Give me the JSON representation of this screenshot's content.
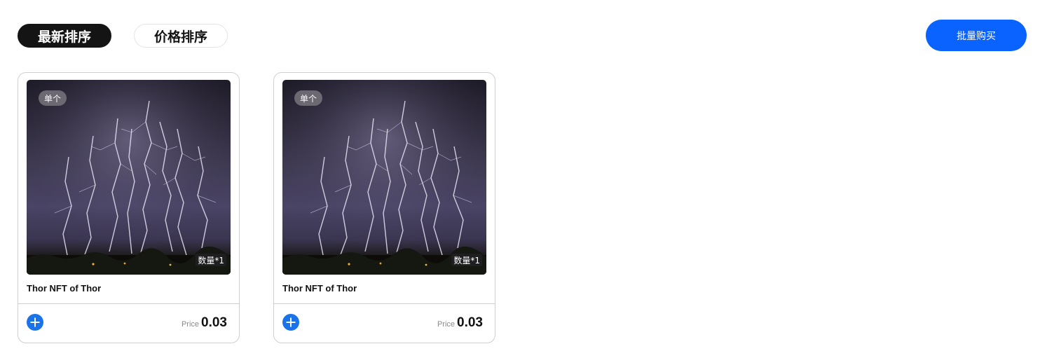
{
  "sort": {
    "latest_label": "最新排序",
    "price_label": "价格排序"
  },
  "bulk_buy_label": "批量购买",
  "cards": [
    {
      "type_badge": "单个",
      "quantity_badge": "数量*1",
      "name": "Thor NFT of Thor",
      "price_label": "Price",
      "price_value": "0.03"
    },
    {
      "type_badge": "单个",
      "quantity_badge": "数量*1",
      "name": "Thor NFT of Thor",
      "price_label": "Price",
      "price_value": "0.03"
    }
  ],
  "colors": {
    "accent": "#0a62ff",
    "add_button": "#1a73e8",
    "active_sort_bg": "#141414"
  },
  "icons": {
    "add": "plus-circle-icon",
    "thumbnail": "lightning-storm-image"
  }
}
